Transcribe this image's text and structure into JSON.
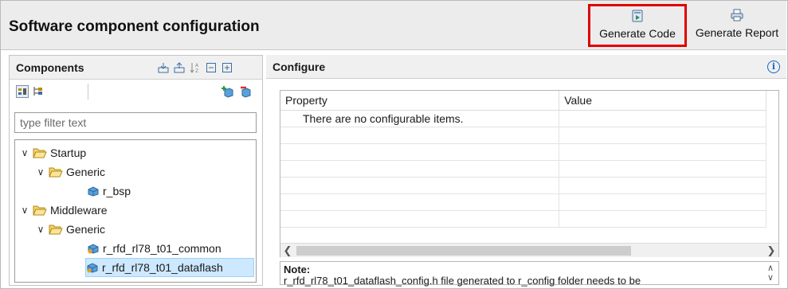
{
  "header": {
    "title": "Software component configuration",
    "generate_code": "Generate Code",
    "generate_report": "Generate Report",
    "highlight_color": "#e00000"
  },
  "components": {
    "title": "Components",
    "filter_placeholder": "type filter text",
    "tree": [
      {
        "label": "Startup",
        "level": 0,
        "type": "folder",
        "expanded": true
      },
      {
        "label": "Generic",
        "level": 1,
        "type": "folder",
        "expanded": true
      },
      {
        "label": "r_bsp",
        "level": 2,
        "type": "component"
      },
      {
        "label": "Middleware",
        "level": 0,
        "type": "folder",
        "expanded": true
      },
      {
        "label": "Generic",
        "level": 1,
        "type": "folder",
        "expanded": true
      },
      {
        "label": "r_rfd_rl78_t01_common",
        "level": 2,
        "type": "component"
      },
      {
        "label": "r_rfd_rl78_t01_dataflash",
        "level": 2,
        "type": "component",
        "selected": true
      }
    ]
  },
  "configure": {
    "title": "Configure",
    "columns": [
      "Property",
      "Value"
    ],
    "empty_message": "There are no configurable items.",
    "note_title": "Note:",
    "note_text": "r_rfd_rl78_t01_dataflash_config.h file generated to r_config folder needs to be"
  }
}
